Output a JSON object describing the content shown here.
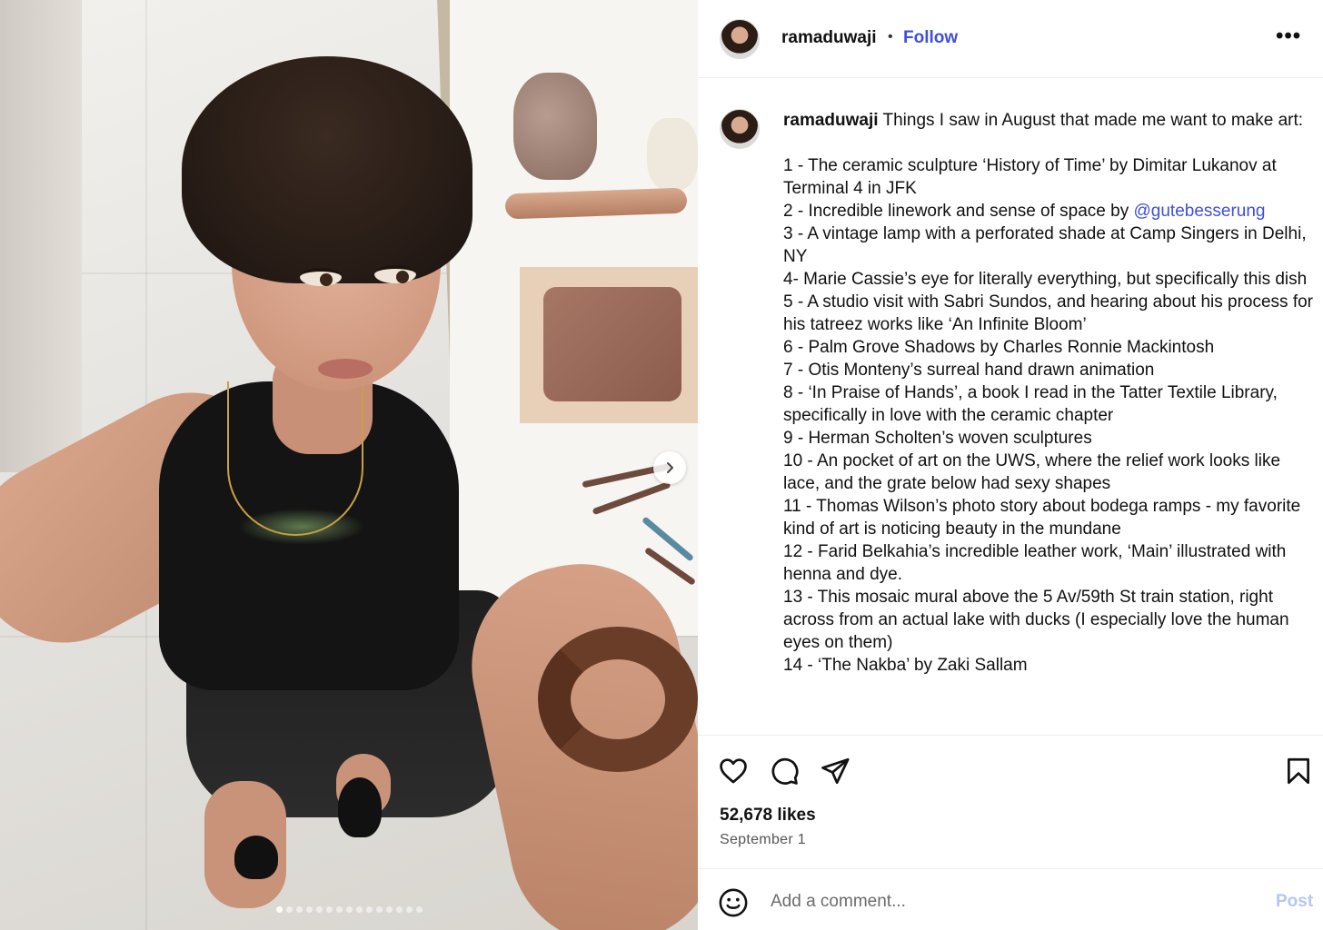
{
  "post": {
    "username": "ramaduwaji",
    "separator": "•",
    "follow_label": "Follow",
    "more_label": "•••",
    "carousel": {
      "total_slides": 15,
      "active_index": 0
    }
  },
  "caption": {
    "username": "ramaduwaji",
    "intro": "Things I saw in August that made me want to make art:",
    "items": [
      "1 - The ceramic sculpture ‘History of Time’ by Dimitar Lukanov at Terminal 4 in JFK",
      "2 - Incredible linework and sense of space by ",
      "3 - A vintage lamp with a perforated shade at Camp Singers in Delhi, NY",
      "4- Marie Cassie’s eye for literally everything, but specifically this dish",
      "5 - A studio visit with Sabri Sundos, and hearing about his process for his tatreez works like ‘An Infinite Bloom’",
      "6 - Palm Grove Shadows by Charles Ronnie Mackintosh",
      "7 - Otis Monteny’s surreal hand drawn animation",
      "8 - ‘In Praise of Hands’, a book I read in the Tatter Textile Library, specifically in love with the ceramic chapter",
      "9 - Herman Scholten’s woven sculptures",
      "10 - An pocket of art on the UWS, where the relief work looks like lace, and the grate below had sexy shapes",
      "11 - Thomas Wilson’s photo story about bodega ramps - my favorite kind of art is noticing beauty in the mundane",
      "12 - Farid Belkahia’s incredible leather work, ‘Main’ illustrated with henna and dye.",
      "13 - This mosaic mural above the 5 Av/59th St train station, right across from an actual lake with ducks (I especially love the human eyes on them)",
      "14 - ‘The Nakba’ by Zaki Sallam"
    ],
    "mention": "@gutebesserung"
  },
  "stats": {
    "likes": "52,678 likes",
    "date": "September 1"
  },
  "comment": {
    "placeholder": "Add a comment...",
    "post_label": "Post"
  },
  "icons": {
    "like": "heart-icon",
    "comment": "comment-bubble-icon",
    "share": "paper-plane-icon",
    "save": "bookmark-icon",
    "emoji": "smiley-icon",
    "next": "chevron-right-icon"
  },
  "colors": {
    "link": "#3f4fd8",
    "post_disabled": "#b4c6f2",
    "divider": "#efefef"
  }
}
